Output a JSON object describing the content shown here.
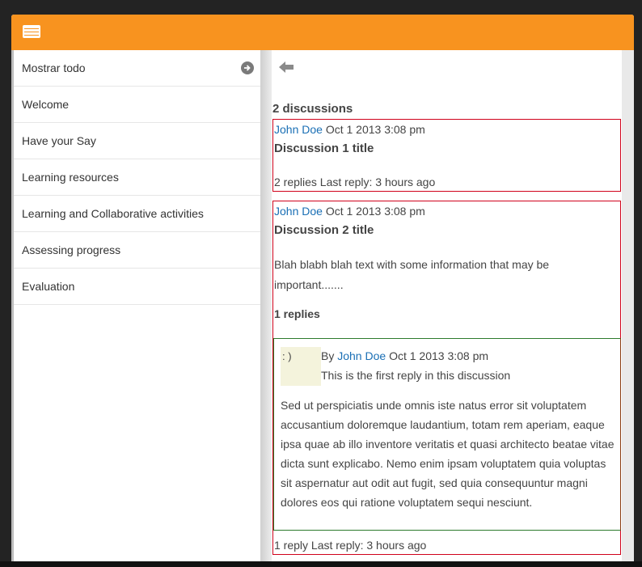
{
  "sidebar": {
    "items": [
      {
        "label": "Mostrar todo"
      },
      {
        "label": "Welcome"
      },
      {
        "label": "Have your Say"
      },
      {
        "label": "Learning resources"
      },
      {
        "label": "Learning and Collaborative activities"
      },
      {
        "label": "Assessing progress"
      },
      {
        "label": "Evaluation"
      }
    ]
  },
  "main": {
    "count_title": "2 discussions",
    "discussions": [
      {
        "author": "John Doe",
        "date": "Oct 1 2013 3:08 pm",
        "title": "Discussion 1 title",
        "footer": "2 replies Last reply: 3 hours ago"
      },
      {
        "author": "John Doe",
        "date": "Oct 1 2013 3:08 pm",
        "title": "Discussion 2 title",
        "body": "Blah blabh blah text with some information that may be important.......",
        "replies_count": "1 replies",
        "reply": {
          "avatar_text": ": )",
          "by": "By",
          "author": "John Doe",
          "date": "Oct 1 2013 3:08 pm",
          "subtitle": "This is the first reply in this discussion",
          "body": "Sed ut perspiciatis unde omnis iste natus error sit voluptatem accusantium doloremque laudantium, totam rem aperiam, eaque ipsa quae ab illo inventore veritatis et quasi architecto beatae vitae dicta sunt explicabo. Nemo enim ipsam voluptatem quia voluptas sit aspernatur aut odit aut fugit, sed quia consequuntur magni dolores eos qui ratione voluptatem sequi nesciunt."
        },
        "footer": "1 reply Last reply: 3 hours ago"
      }
    ]
  },
  "colors": {
    "topbar": "#f8931f",
    "link": "#1a6fb5",
    "discussion_border": "#d0021b",
    "reply_border": "#2c7a2c"
  }
}
